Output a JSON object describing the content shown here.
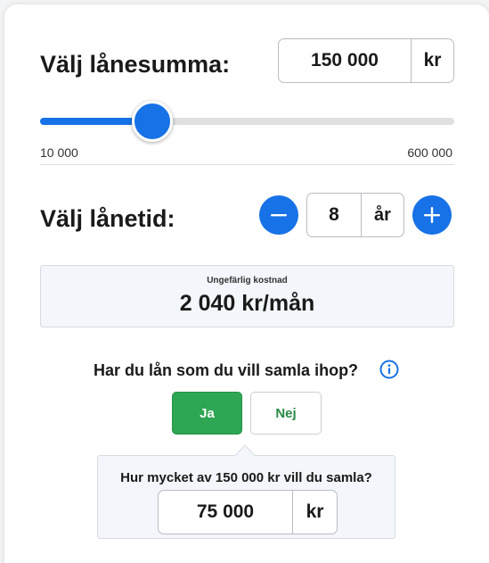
{
  "loan_amount": {
    "title": "Välj lånesumma:",
    "value": "150 000",
    "unit": "kr",
    "slider": {
      "min_label": "10 000",
      "max_label": "600 000",
      "fraction": 0.27
    }
  },
  "loan_term": {
    "title": "Välj lånetid:",
    "value": "8",
    "unit": "år"
  },
  "cost": {
    "label": "Ungefärlig kostnad",
    "value": "2 040 kr/mån"
  },
  "consolidate": {
    "question": "Har du lån som du vill samla ihop?",
    "yes_label": "Ja",
    "no_label": "Nej",
    "amount_question": "Hur mycket av 150 000 kr vill du samla?",
    "amount_value": "75 000",
    "amount_unit": "kr"
  },
  "colors": {
    "primary_blue": "#1672e6",
    "green": "#2ea653",
    "panel_bg": "#f3f6fa"
  }
}
